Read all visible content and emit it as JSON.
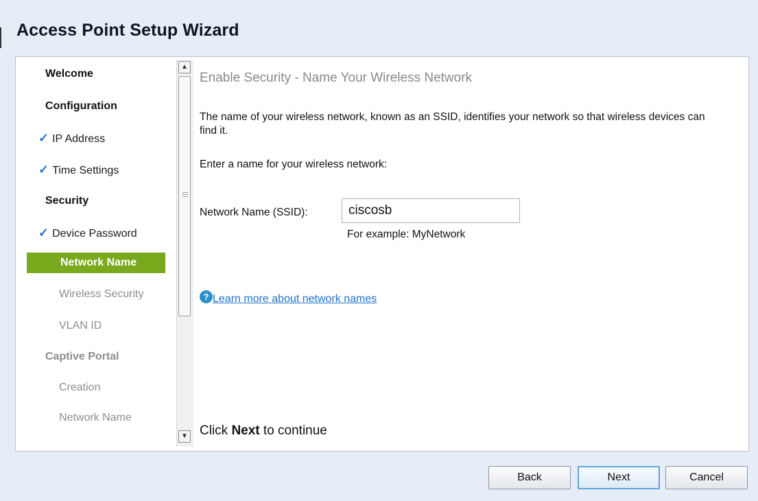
{
  "wizard": {
    "title": "Access Point Setup Wizard"
  },
  "sidebar": {
    "items": [
      {
        "label": "Welcome",
        "state": "heading"
      },
      {
        "label": "Configuration",
        "state": "heading"
      },
      {
        "label": "IP Address",
        "state": "done"
      },
      {
        "label": "Time Settings",
        "state": "done"
      },
      {
        "label": "Security",
        "state": "heading"
      },
      {
        "label": "Device Password",
        "state": "done"
      },
      {
        "label": "Network Name",
        "state": "active"
      },
      {
        "label": "Wireless Security",
        "state": "pending"
      },
      {
        "label": "VLAN ID",
        "state": "pending"
      },
      {
        "label": "Captive Portal",
        "state": "pending-heading"
      },
      {
        "label": "Creation",
        "state": "pending"
      },
      {
        "label": "Network Name",
        "state": "pending"
      }
    ],
    "check_glyph": "✓"
  },
  "main": {
    "step_title": "Enable Security - Name Your Wireless Network",
    "intro": "The name of your wireless network, known as an SSID, identifies your network so that wireless devices can find it.",
    "prompt": "Enter a name for your wireless network:",
    "field_label": "Network Name (SSID):",
    "ssid_value": "ciscosb",
    "hint": "For example: MyNetwork",
    "help_link": "Learn more about network names",
    "continue_prefix": "Click ",
    "continue_bold": "Next",
    "continue_suffix": " to continue"
  },
  "buttons": {
    "back": "Back",
    "next": "Next",
    "cancel": "Cancel"
  },
  "colors": {
    "active_item": "#79aa1e",
    "check": "#2d6fd0",
    "link": "#1f73c8",
    "help_icon": "#2f8fc8"
  },
  "icons": {
    "help": "help-circle-icon",
    "check": "checkmark-icon",
    "scroll_up": "chevron-up-icon",
    "scroll_down": "chevron-down-icon"
  }
}
